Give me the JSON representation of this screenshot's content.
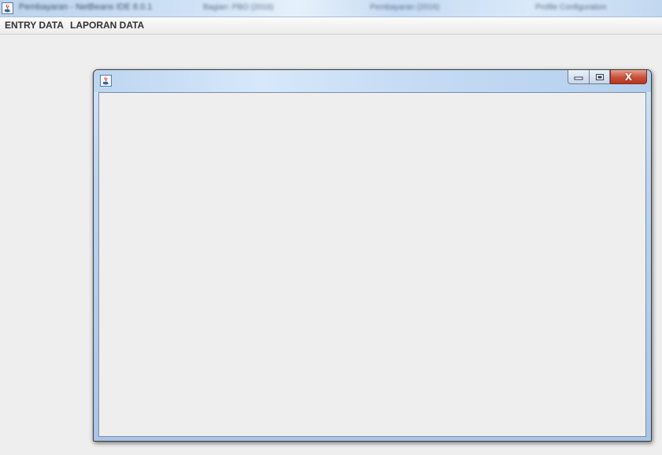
{
  "window": {
    "title": "Pembayaran - NetBeans IDE 8.0.1",
    "taskbar_items": [
      "Bagian: PBO (2016)",
      "Pembayaran (2016)",
      "Profile Configuration"
    ]
  },
  "menubar": {
    "items": [
      {
        "label": "ENTRY DATA"
      },
      {
        "label": "LAPORAN DATA"
      }
    ]
  },
  "internal_frame": {
    "title": "",
    "controls": {
      "minimize_icon": "minimize-icon",
      "maximize_icon": "restore-icon",
      "close_icon": "close-icon",
      "close_symbol": "X"
    }
  },
  "colors": {
    "close_button": "#c8503a",
    "title_gradient": "#c3d9f2",
    "content_background": "#eeeeee"
  }
}
